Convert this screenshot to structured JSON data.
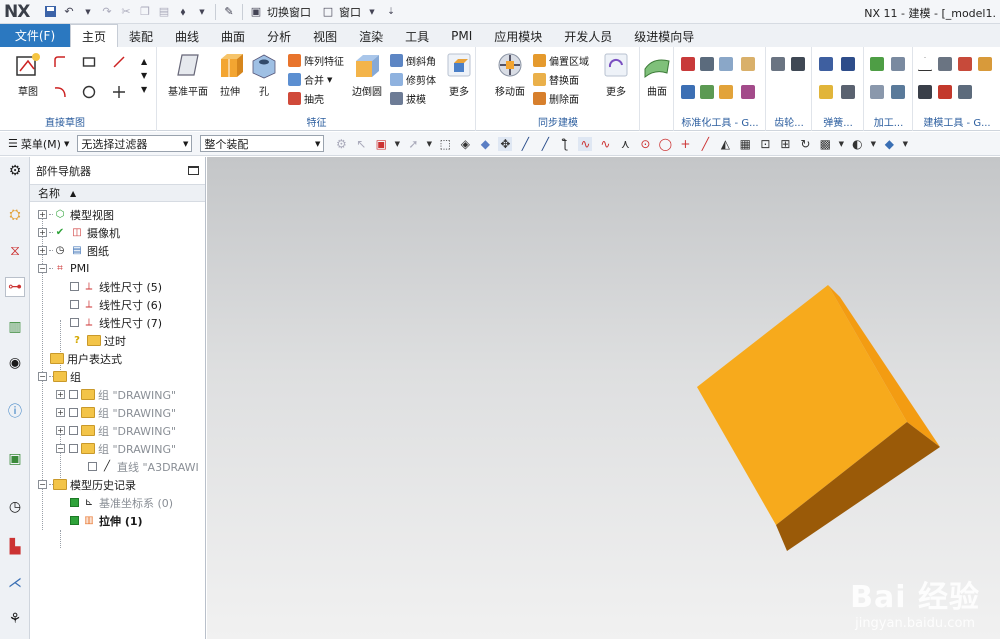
{
  "app": {
    "logo": "NX",
    "title": "NX 11 - 建模 - [_model1.",
    "quick_access": {
      "switch_window": "切换窗口",
      "window": "窗口"
    }
  },
  "tabs": {
    "file": "文件(F)",
    "items": [
      "主页",
      "装配",
      "曲线",
      "曲面",
      "分析",
      "视图",
      "渲染",
      "工具",
      "PMI",
      "应用模块",
      "开发人员",
      "级进模向导"
    ],
    "active": "主页"
  },
  "ribbon": {
    "sketch": {
      "label": "草图",
      "group": "直接草图"
    },
    "feature": {
      "group": "特征",
      "datum_plane": "基准平面",
      "extrude": "拉伸",
      "hole": "孔",
      "pattern_feature": "阵列特征",
      "unite": "合并",
      "shell": "抽壳",
      "edge_blend": "边倒圆",
      "chamfer": "倒斜角",
      "trim_body": "修剪体",
      "draft": "拔模",
      "more": "更多"
    },
    "sync": {
      "group": "同步建模",
      "move_face": "移动面",
      "offset_region": "偏置区域",
      "replace_face": "替换面",
      "delete_face": "删除面",
      "more": "更多"
    },
    "surface": {
      "label": "曲面"
    },
    "groups_right": [
      "标准化工具 - G...",
      "齿轮...",
      "弹簧...",
      "加工...",
      "建模工具 - G..."
    ]
  },
  "cmdbar": {
    "menu": "菜单(M)",
    "filter": "无选择过滤器",
    "scope": "整个装配"
  },
  "navigator": {
    "title": "部件导航器",
    "column": "名称",
    "rows": [
      {
        "label": "模型视图",
        "style": "normal"
      },
      {
        "label": "摄像机",
        "style": "normal"
      },
      {
        "label": "图纸",
        "style": "normal"
      },
      {
        "label": "PMI",
        "style": "normal"
      },
      {
        "label": "线性尺寸 (5)",
        "style": "normal"
      },
      {
        "label": "线性尺寸 (6)",
        "style": "normal"
      },
      {
        "label": "线性尺寸 (7)",
        "style": "normal"
      },
      {
        "label": "过时",
        "style": "normal"
      },
      {
        "label": "用户表达式",
        "style": "normal"
      },
      {
        "label": "组",
        "style": "normal"
      },
      {
        "label": "组 \"DRAWING\"",
        "style": "gray"
      },
      {
        "label": "组 \"DRAWING\"",
        "style": "gray"
      },
      {
        "label": "组 \"DRAWING\"",
        "style": "gray"
      },
      {
        "label": "组 \"DRAWING\"",
        "style": "gray"
      },
      {
        "label": "直线 \"A3DRAWI",
        "style": "gray"
      },
      {
        "label": "模型历史记录",
        "style": "normal"
      },
      {
        "label": "基准坐标系 (0)",
        "style": "gray"
      },
      {
        "label": "拉伸 (1)",
        "style": "bold"
      }
    ]
  },
  "watermark": {
    "brand": "Bai 经验",
    "url": "jingyan.baidu.com"
  },
  "colors": {
    "file_tab": "#2b78c0",
    "cube_front": "#f7aa1c",
    "cube_side": "#f39c12",
    "cube_bottom": "#9a5a08"
  }
}
